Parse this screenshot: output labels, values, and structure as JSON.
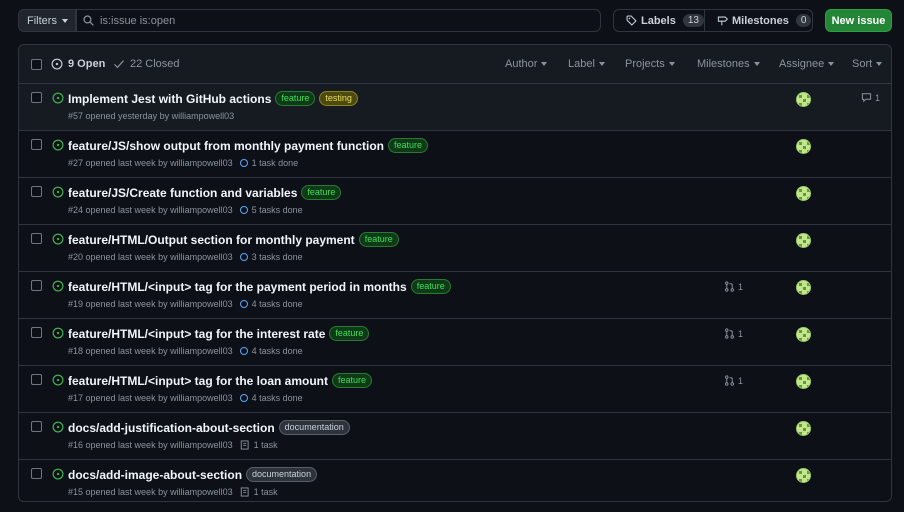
{
  "toolbar": {
    "filters_label": "Filters",
    "search_value": "is:issue is:open",
    "labels_label": "Labels",
    "labels_count": "13",
    "milestones_label": "Milestones",
    "milestones_count": "0",
    "new_issue_label": "New issue"
  },
  "header": {
    "open_label": "9 Open",
    "closed_label": "22 Closed",
    "filters": [
      "Author",
      "Label",
      "Projects",
      "Milestones",
      "Assignee",
      "Sort"
    ]
  },
  "colors": {
    "open_icon": "#3fb950",
    "accent_green": "#238636"
  },
  "issues": [
    {
      "title": "Implement Jest with GitHub actions",
      "labels": [
        "feature",
        "testing"
      ],
      "meta": "#57 opened yesterday by williampowell03",
      "task": "",
      "pr": "",
      "comments": "1"
    },
    {
      "title": "feature/JS/show output from monthly payment function",
      "labels": [
        "feature"
      ],
      "meta": "#27 opened last week by williampowell03",
      "task": "1 task done",
      "pr": "",
      "comments": ""
    },
    {
      "title": "feature/JS/Create function and variables",
      "labels": [
        "feature"
      ],
      "meta": "#24 opened last week by williampowell03",
      "task": "5 tasks done",
      "pr": "",
      "comments": ""
    },
    {
      "title": "feature/HTML/Output section for monthly payment",
      "labels": [
        "feature"
      ],
      "meta": "#20 opened last week by williampowell03",
      "task": "3 tasks done",
      "pr": "",
      "comments": ""
    },
    {
      "title": "feature/HTML/<input> tag for the payment period in months",
      "labels": [
        "feature"
      ],
      "meta": "#19 opened last week by williampowell03",
      "task": "4 tasks done",
      "pr": "1",
      "comments": ""
    },
    {
      "title": "feature/HTML/<input> tag for the interest rate",
      "labels": [
        "feature"
      ],
      "meta": "#18 opened last week by williampowell03",
      "task": "4 tasks done",
      "pr": "1",
      "comments": ""
    },
    {
      "title": "feature/HTML/<input> tag for the loan amount",
      "labels": [
        "feature"
      ],
      "meta": "#17 opened last week by williampowell03",
      "task": "4 tasks done",
      "pr": "1",
      "comments": ""
    },
    {
      "title": "docs/add-justification-about-section",
      "labels": [
        "documentation"
      ],
      "meta": "#16 opened last week by williampowell03",
      "task": "1 task",
      "pr": "",
      "comments": ""
    },
    {
      "title": "docs/add-image-about-section",
      "labels": [
        "documentation"
      ],
      "meta": "#15 opened last week by williampowell03",
      "task": "1 task",
      "pr": "",
      "comments": ""
    }
  ]
}
